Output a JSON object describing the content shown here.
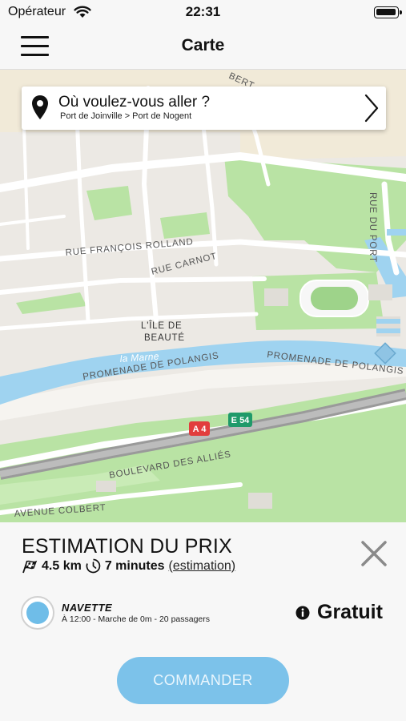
{
  "status_bar": {
    "carrier": "Opérateur",
    "time": "22:31"
  },
  "nav": {
    "title": "Carte"
  },
  "search": {
    "title": "Où voulez-vous aller ?",
    "route": "Port de Joinville > Port de Nogent"
  },
  "map": {
    "labels": {
      "rue_francois_rolland": "RUE FRANÇOIS ROLLAND",
      "rue_carnot": "RUE CARNOT",
      "ile_line1": "L'ÎLE DE",
      "ile_line2": "BEAUTÉ",
      "river": "la Marne",
      "promenade_left": "PROMENADE DE POLANGIS",
      "promenade_right": "PROMENADE DE POLANGIS",
      "rue_du_port": "RUE DU PORT",
      "boulevard": "BOULEVARD DES ALLIÉS",
      "avenue": "AVENUE COLBERT",
      "bert": "BERT",
      "shield_a4": "A 4",
      "shield_e54": "E 54"
    },
    "colors": {
      "water": "#9fd3f0",
      "park": "#b9e3a4",
      "land": "#ece9e4",
      "road": "#ffffff",
      "a4": "#e23d3d",
      "e54": "#1f9a6a"
    }
  },
  "estimate": {
    "title": "ESTIMATION DU PRIX",
    "distance": "4.5 km",
    "duration": "7 minutes",
    "link": "(estimation)"
  },
  "option": {
    "name": "NAVETTE",
    "detail": "À 12:00 - Marche de 0m - 20 passagers",
    "price": "Gratuit",
    "selected_color": "#6fbde8"
  },
  "order_button": {
    "label": "COMMANDER"
  },
  "icons": [
    "wifi-icon",
    "battery-icon",
    "menu-icon",
    "map-pin-icon",
    "chevron-right-icon",
    "close-icon",
    "checkered-flag-icon",
    "clock-icon",
    "info-icon"
  ]
}
